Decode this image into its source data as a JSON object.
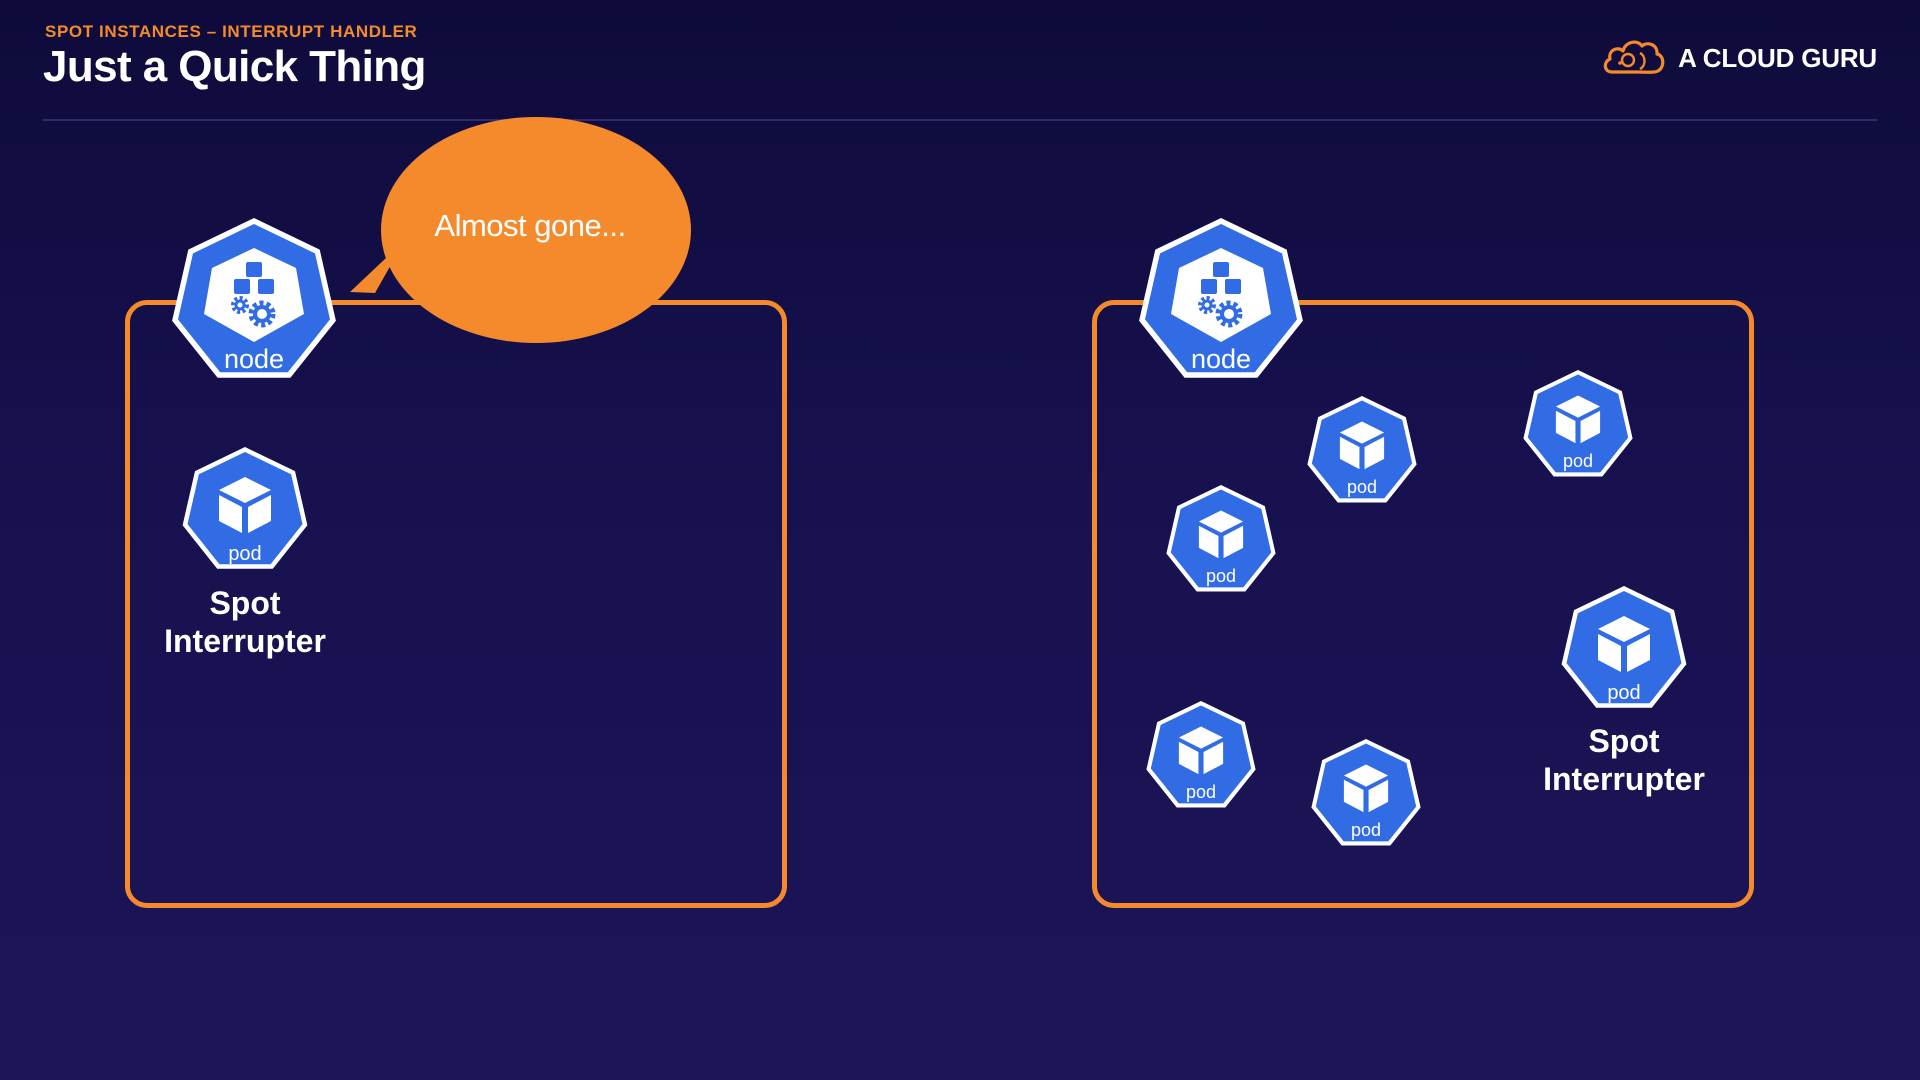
{
  "header": {
    "kicker": "SPOT INSTANCES – INTERRUPT HANDLER",
    "title": "Just a Quick Thing"
  },
  "brand": {
    "name": "A CLOUD GURU",
    "icon": "cloud-logo-icon"
  },
  "colors": {
    "accent_orange": "#f58a2c",
    "k8s_blue": "#326ce5",
    "background_top": "#0e0b3b",
    "background_bottom": "#1c1558"
  },
  "diagram": {
    "left_panel": {
      "node_label": "node",
      "speech_bubble": "Almost gone...",
      "pod_label": "pod",
      "caption_line1": "Spot",
      "caption_line2": "Interrupter"
    },
    "right_panel": {
      "node_label": "node",
      "pods": [
        {
          "label": "pod"
        },
        {
          "label": "pod"
        },
        {
          "label": "pod"
        },
        {
          "label": "pod"
        },
        {
          "label": "pod"
        }
      ],
      "interrupter_pod_label": "pod",
      "caption_line1": "Spot",
      "caption_line2": "Interrupter"
    }
  }
}
